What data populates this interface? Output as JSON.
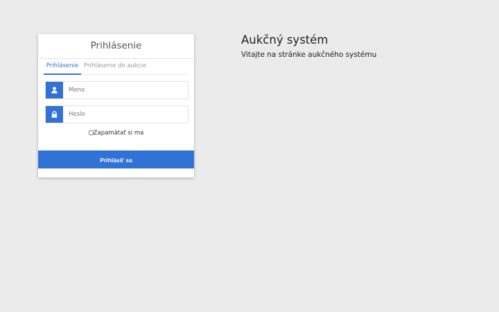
{
  "login": {
    "title": "Prihlásenie",
    "tabs": [
      {
        "label": "Prihlásenie",
        "active": true
      },
      {
        "label": "Prihlásenie do aukcie",
        "active": false
      }
    ],
    "username": {
      "placeholder": "Meno",
      "value": "",
      "icon": "user-icon"
    },
    "password": {
      "placeholder": "Heslo",
      "value": "",
      "icon": "lock-icon"
    },
    "remember_label": "Zapamätať si ma",
    "remember_checked": false,
    "submit_label": "Prihlásiť sa"
  },
  "welcome": {
    "title": "Aukčný systém",
    "subtitle": "Vitajte na stránke aukčného systému"
  },
  "colors": {
    "accent": "#3072d6",
    "background": "#ebebeb",
    "card": "#ffffff"
  }
}
